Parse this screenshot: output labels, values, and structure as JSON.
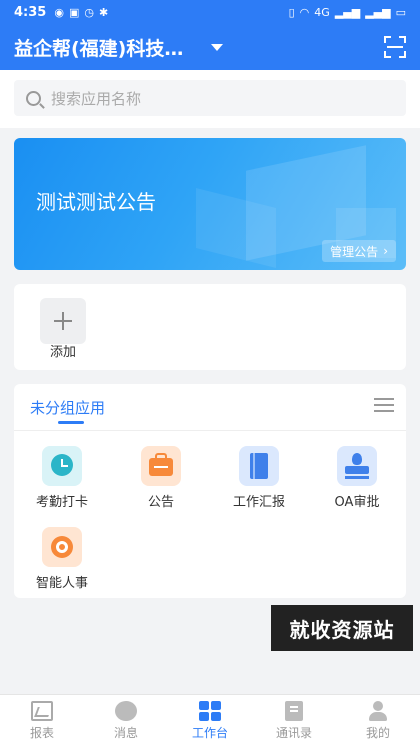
{
  "status_bar": {
    "time": "4:35",
    "left_icons": [
      "eye-icon",
      "nfc-icon",
      "alarm-icon",
      "bluetooth-icon"
    ],
    "right_icons": [
      "vibrate-icon",
      "wifi-icon",
      "signal-icon",
      "signal-icon",
      "battery-icon"
    ],
    "signal_label": "4G"
  },
  "header": {
    "company": "益企帮(福建)科技…",
    "scan_icon": "scan-icon"
  },
  "search": {
    "placeholder": "搜索应用名称"
  },
  "banner": {
    "title": "测试测试公告",
    "button_label": "管理公告",
    "button_chevron": "›"
  },
  "quick_add": {
    "label": "添加"
  },
  "app_group": {
    "title": "未分组应用",
    "apps": [
      {
        "label": "考勤打卡",
        "icon": "clock-icon"
      },
      {
        "label": "公告",
        "icon": "notice-icon"
      },
      {
        "label": "工作汇报",
        "icon": "report-icon"
      },
      {
        "label": "OA审批",
        "icon": "stamp-icon"
      },
      {
        "label": "智能人事",
        "icon": "hr-icon"
      }
    ]
  },
  "watermark": {
    "text": "就收资源站"
  },
  "tabbar": {
    "tabs": [
      {
        "label": "报表",
        "icon": "chart-report-icon",
        "active": false
      },
      {
        "label": "消息",
        "icon": "message-icon",
        "active": false
      },
      {
        "label": "工作台",
        "icon": "workbench-icon",
        "active": true
      },
      {
        "label": "通讯录",
        "icon": "contacts-icon",
        "active": false
      },
      {
        "label": "我的",
        "icon": "profile-icon",
        "active": false
      }
    ]
  },
  "colors": {
    "primary": "#2d7cf6",
    "background": "#f2f3f5",
    "orange": "#f7893a",
    "teal": "#2bb5c8"
  }
}
